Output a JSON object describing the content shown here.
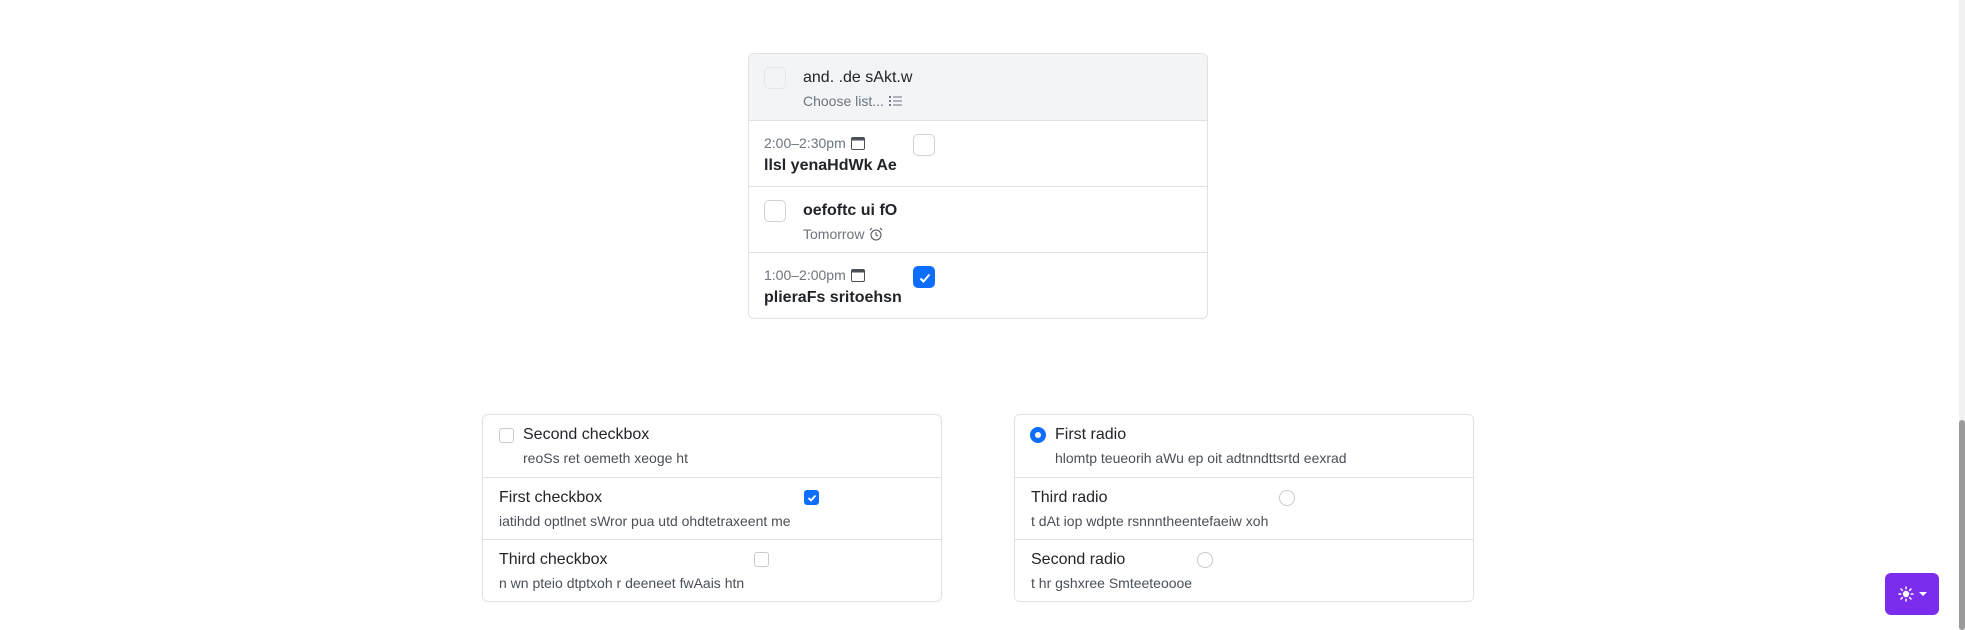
{
  "tasks": [
    {
      "title": "and. .de sAkt.w",
      "subtitle": "Choose list...",
      "subtitle_icon": "list-icon",
      "checked": false
    },
    {
      "time": "2:00–2:30pm",
      "time_icon": "calendar-icon",
      "title": "llsl yenaHdWk Ae",
      "checked": false
    },
    {
      "title": "oefoftc ui fO",
      "subtitle": "Tomorrow",
      "subtitle_icon": "alarm-clock-icon",
      "checked": false
    },
    {
      "time": "1:00–2:00pm",
      "time_icon": "calendar-icon",
      "title": "plieraFs sritoehsn",
      "checked": true
    }
  ],
  "checkbox_group": [
    {
      "label": "Second checkbox",
      "description": "reoSs ret oemeth xeoge ht",
      "checked": false
    },
    {
      "label": "First checkbox",
      "description": "iatihdd optlnet sWror pua utd ohdtetraxeent me",
      "checked": true
    },
    {
      "label": "Third checkbox",
      "description": "n wn pteio dtptxoh r deeneet fwAais htn",
      "checked": false
    }
  ],
  "radio_group": [
    {
      "label": "First radio",
      "description": "hlomtp teueorih aWu ep oit adtnndttsrtd eexrad",
      "checked": true
    },
    {
      "label": "Third radio",
      "description": "t dAt iop wdpte rsnnntheentefaeiw xoh",
      "checked": false
    },
    {
      "label": "Second radio",
      "description": "t hr gshxree Smteeteoooe",
      "checked": false
    }
  ],
  "theme_toggle": {
    "icon": "sun-icon",
    "caret_icon": "caret-down-icon"
  },
  "colors": {
    "primary": "#0d6efd",
    "accent": "#7c2ced",
    "border": "#dee2e6",
    "muted": "#6c757d"
  }
}
